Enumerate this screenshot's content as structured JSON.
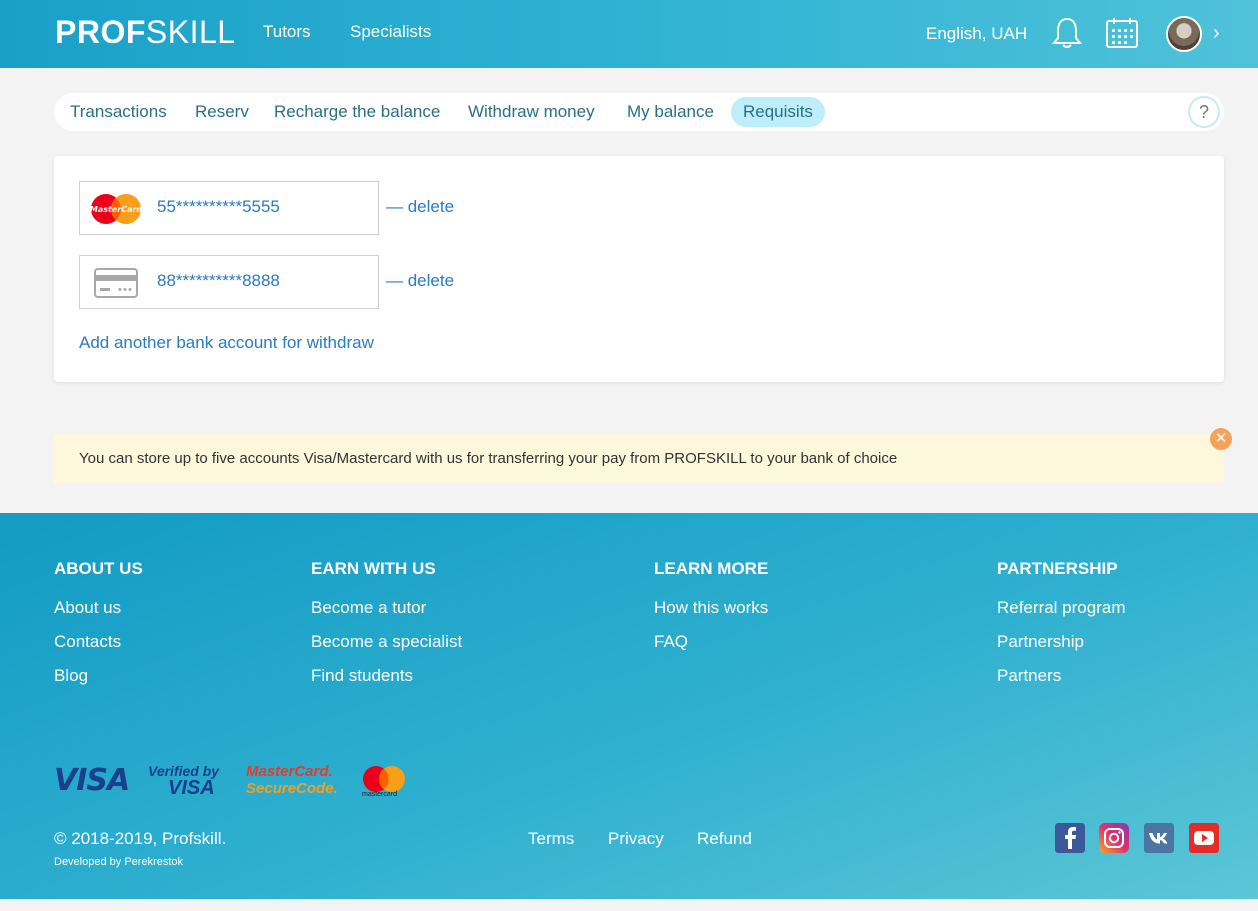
{
  "header": {
    "logo_bold": "PROF",
    "logo_light": "SKILL",
    "nav": [
      "Tutors",
      "Specialists"
    ],
    "language_currency": "English, UAH"
  },
  "tabs": {
    "items": [
      "Transactions",
      "Reserv",
      "Recharge the balance",
      "Withdraw money",
      "My balance",
      "Requisits"
    ],
    "active": "Requisits",
    "help": "?"
  },
  "accounts": {
    "cards": [
      {
        "type": "mastercard",
        "number": "55**********5555",
        "delete_label": "— delete"
      },
      {
        "type": "generic-card",
        "number": "88**********8888",
        "delete_label": "— delete"
      }
    ],
    "add_label": "Add another bank account for withdraw"
  },
  "notice": {
    "text": "You can store up to five accounts Visa/Mastercard with us for transferring your pay from PROFSKILL to your bank of choice",
    "close": "✕"
  },
  "footer": {
    "columns": [
      {
        "heading": "ABOUT US",
        "links": [
          "About us",
          "Contacts",
          "Blog"
        ]
      },
      {
        "heading": "EARN WITH US",
        "links": [
          "Become a tutor",
          "Become a specialist",
          "Find students"
        ]
      },
      {
        "heading": "LEARN MORE",
        "links": [
          "How this works",
          "FAQ"
        ]
      },
      {
        "heading": "PARTNERSHIP",
        "links": [
          "Referral program",
          "Partnership",
          "Partners"
        ]
      }
    ],
    "payment_logos": {
      "visa": "VISA",
      "verified_top": "Verified by",
      "verified_bottom": "VISA",
      "securecode_top": "MasterCard.",
      "securecode_bottom": "SecureCode.",
      "mastercard": "mastercard"
    },
    "copyright": "© 2018-2019, Profskill.",
    "developed_by": "Developed by Perekrestok",
    "bottom_links": [
      "Terms",
      "Privacy",
      "Refund"
    ],
    "social": [
      "facebook-icon",
      "instagram-icon",
      "vk-icon",
      "youtube-icon"
    ]
  },
  "colors": {
    "header_start": "#1aa0c8",
    "accent_link": "#2a7bc4",
    "active_tab": "#bdeefa",
    "notice_bg": "#fdf7dc"
  }
}
